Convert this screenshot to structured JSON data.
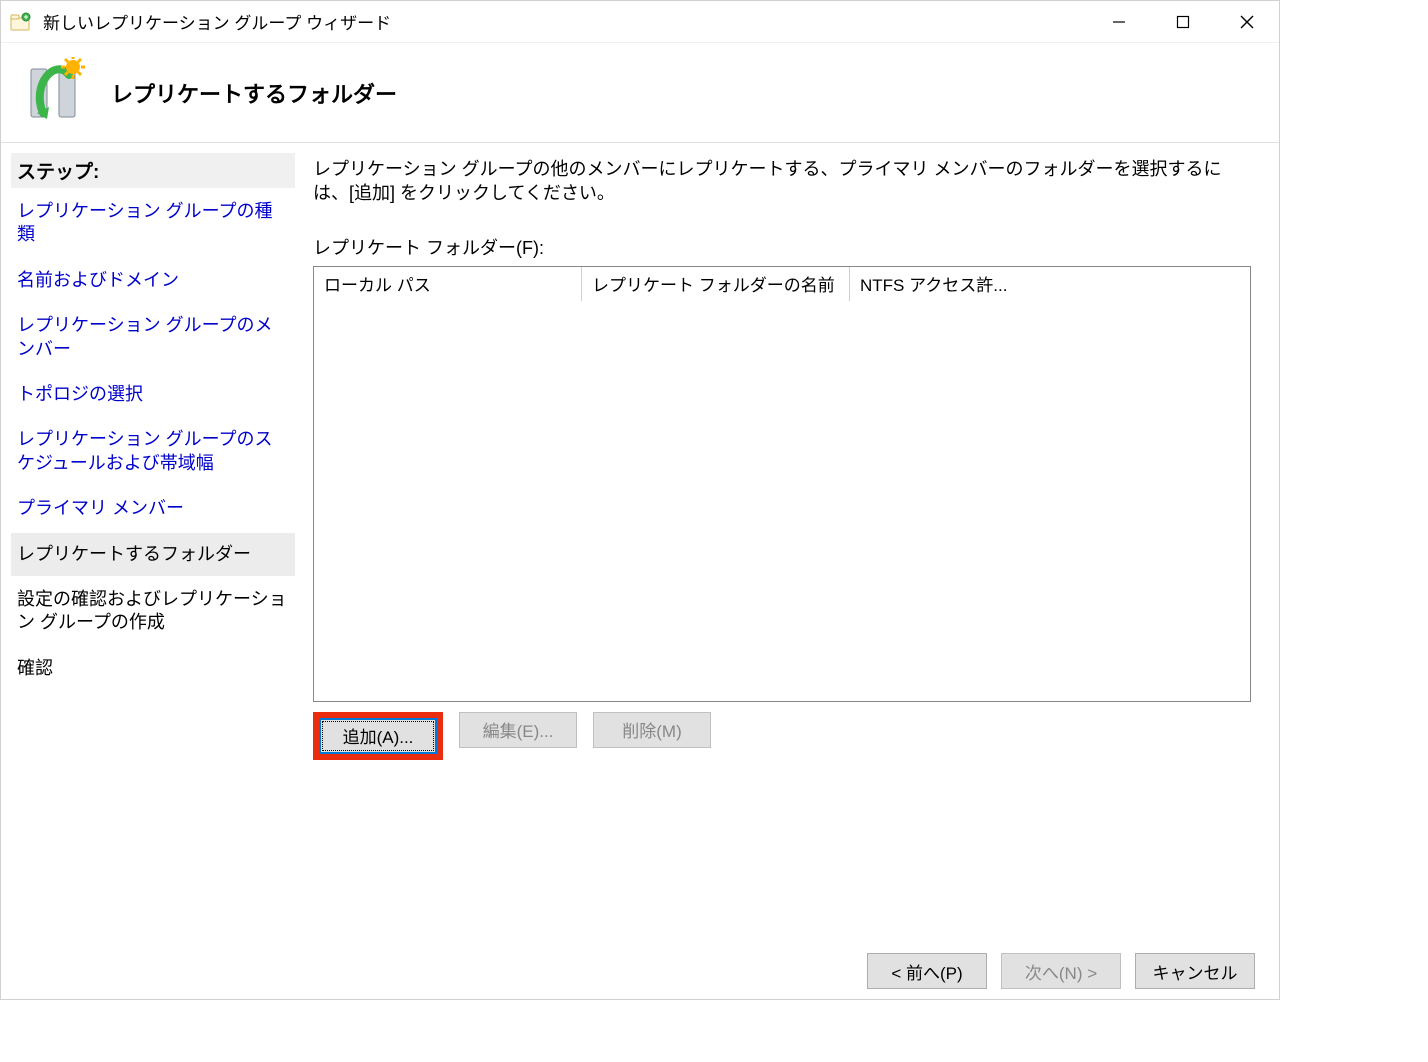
{
  "titlebar": {
    "title": "新しいレプリケーション グループ ウィザード"
  },
  "header": {
    "title": "レプリケートするフォルダー"
  },
  "sidebar": {
    "header": "ステップ:",
    "items": [
      {
        "label": "レプリケーション グループの種類",
        "state": "link"
      },
      {
        "label": "名前およびドメイン",
        "state": "link"
      },
      {
        "label": "レプリケーション グループのメンバー",
        "state": "link"
      },
      {
        "label": "トポロジの選択",
        "state": "link"
      },
      {
        "label": "レプリケーション グループのスケジュールおよび帯域幅",
        "state": "link"
      },
      {
        "label": "プライマリ メンバー",
        "state": "link"
      },
      {
        "label": "レプリケートするフォルダー",
        "state": "active"
      },
      {
        "label": "設定の確認およびレプリケーション グループの作成",
        "state": "pending"
      },
      {
        "label": "確認",
        "state": "pending"
      }
    ]
  },
  "content": {
    "instruction": "レプリケーション グループの他のメンバーにレプリケートする、プライマリ メンバーのフォルダーを選択するには、[追加] をクリックしてください。",
    "field_label": "レプリケート フォルダー(F):",
    "columns": {
      "local_path": "ローカル パス",
      "folder_name": "レプリケート フォルダーの名前",
      "ntfs": "NTFS アクセス許..."
    },
    "buttons": {
      "add": "追加(A)...",
      "edit": "編集(E)...",
      "remove": "削除(M)"
    }
  },
  "footer": {
    "back": "< 前へ(P)",
    "next": "次へ(N) >",
    "cancel": "キャンセル"
  }
}
